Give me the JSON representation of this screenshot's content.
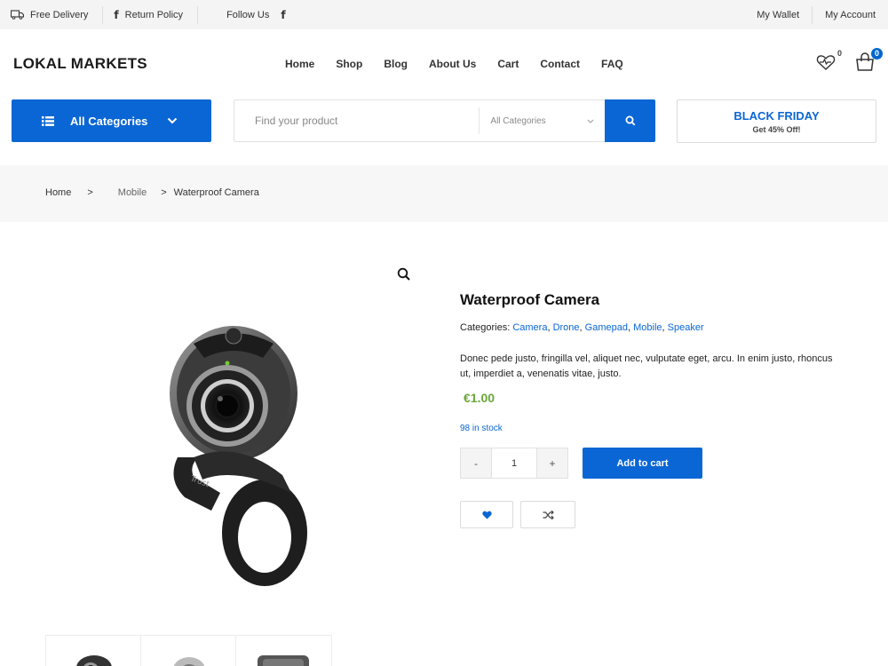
{
  "topbar": {
    "delivery": "Free Delivery",
    "return_policy": "Return Policy",
    "follow_us": "Follow Us",
    "wallet": "My Wallet",
    "account": "My Account"
  },
  "header": {
    "logo": "LOKAL MARKETS",
    "nav": [
      "Home",
      "Shop",
      "Blog",
      "About Us",
      "Cart",
      "Contact",
      "FAQ"
    ],
    "wishlist_count": "0",
    "cart_count": "0"
  },
  "category_button": {
    "label": "All Categories"
  },
  "search": {
    "placeholder": "Find your product",
    "category_select": "All Categories"
  },
  "promo": {
    "title": "BLACK FRIDAY",
    "subtitle": "Get 45% Off!"
  },
  "breadcrumb": {
    "home": "Home",
    "sep1": ">",
    "category": "Mobile",
    "sep2": ">",
    "current": "Waterproof Camera"
  },
  "product": {
    "title": "Waterproof Camera",
    "categories_label": "Categories:",
    "categories": [
      "Camera",
      "Drone",
      "Gamepad",
      "Mobile",
      "Speaker"
    ],
    "description": "Donec pede justo, fringilla vel, aliquet nec, vulputate eget, arcu. In enim justo, rhoncus ut, imperdiet a, venenatis vitae, justo.",
    "price": "€1.00",
    "stock": "98 in stock",
    "quantity": "1",
    "qty_minus": "-",
    "qty_plus": "+",
    "add_to_cart": "Add to cart"
  },
  "colors": {
    "accent": "#0a66d4",
    "price": "#6aa63a"
  }
}
